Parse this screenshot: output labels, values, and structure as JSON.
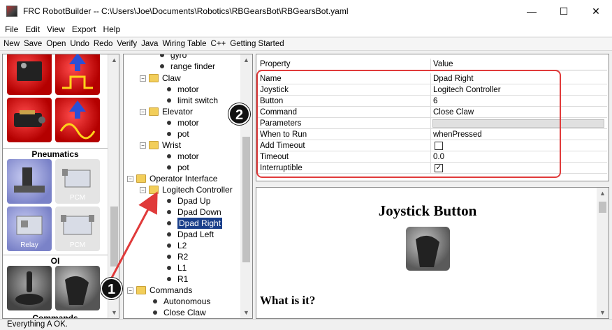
{
  "window": {
    "title": "FRC RobotBuilder -- C:\\Users\\Joe\\Documents\\Robotics\\RBGearsBot\\RBGearsBot.yaml",
    "minimize": "—",
    "maximize": "☐",
    "close": "✕"
  },
  "menu": [
    "File",
    "Edit",
    "View",
    "Export",
    "Help"
  ],
  "toolbar": [
    "New",
    "Save",
    "Open",
    "Undo",
    "Redo",
    "Verify",
    "Java",
    "Wiring Table",
    "C++",
    "Getting Started"
  ],
  "palette": {
    "groups": [
      {
        "label": "Pneumatics"
      },
      {
        "label": "OI"
      },
      {
        "label": "Commands"
      }
    ],
    "tiles": {
      "relay_caption": "Relay",
      "pcm_caption": "PCM"
    }
  },
  "tree": {
    "rows": [
      {
        "label": "gyro",
        "kind": "leaf"
      },
      {
        "label": "range finder",
        "kind": "leaf"
      },
      {
        "label": "Claw",
        "kind": "folder"
      },
      {
        "label": "motor",
        "kind": "leaf"
      },
      {
        "label": "limit switch",
        "kind": "leaf"
      },
      {
        "label": "Elevator",
        "kind": "folder"
      },
      {
        "label": "motor",
        "kind": "leaf"
      },
      {
        "label": "pot",
        "kind": "leaf"
      },
      {
        "label": "Wrist",
        "kind": "folder"
      },
      {
        "label": "motor",
        "kind": "leaf"
      },
      {
        "label": "pot",
        "kind": "leaf"
      },
      {
        "label": "Operator Interface",
        "kind": "folder"
      },
      {
        "label": "Logitech Controller",
        "kind": "folder"
      },
      {
        "label": "Dpad Up",
        "kind": "leaf"
      },
      {
        "label": "Dpad Down",
        "kind": "leaf"
      },
      {
        "label": "Dpad Right",
        "kind": "leaf",
        "selected": true
      },
      {
        "label": "Dpad Left",
        "kind": "leaf"
      },
      {
        "label": "L2",
        "kind": "leaf"
      },
      {
        "label": "R2",
        "kind": "leaf"
      },
      {
        "label": "L1",
        "kind": "leaf"
      },
      {
        "label": "R1",
        "kind": "leaf"
      },
      {
        "label": "Commands",
        "kind": "folder"
      },
      {
        "label": "Autonomous",
        "kind": "leaf"
      },
      {
        "label": "Close Claw",
        "kind": "leaf"
      }
    ]
  },
  "properties": {
    "header": {
      "name": "Property",
      "value": "Value"
    },
    "rows": [
      {
        "name": "Name",
        "value": "Dpad Right"
      },
      {
        "name": "Joystick",
        "value": "Logitech Controller"
      },
      {
        "name": "Button",
        "value": "6"
      },
      {
        "name": "Command",
        "value": "Close Claw"
      },
      {
        "name": "Parameters",
        "value": ""
      },
      {
        "name": "When to Run",
        "value": "whenPressed"
      },
      {
        "name": "Add Timeout",
        "value": ""
      },
      {
        "name": "Timeout",
        "value": "0.0"
      },
      {
        "name": "Interruptible",
        "value": "✓"
      }
    ]
  },
  "help": {
    "title": "Joystick Button",
    "subtitle": "What is it?"
  },
  "status": "Everything A OK.",
  "callouts": {
    "one": "1",
    "two": "2"
  },
  "colors": {
    "annotation_red": "#e03a3a",
    "selection": "#1a3f8a"
  }
}
